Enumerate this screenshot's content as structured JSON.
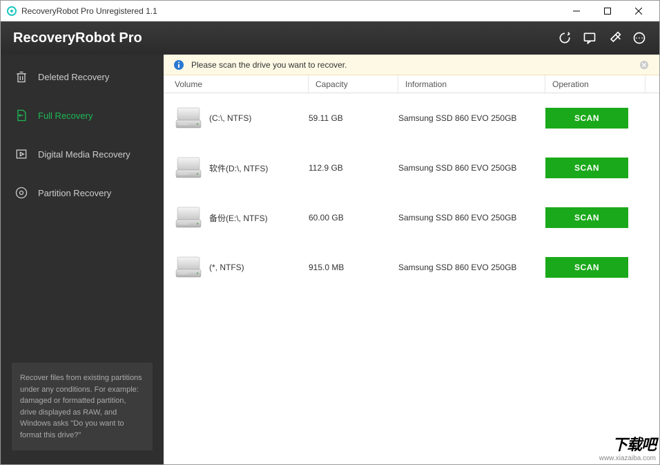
{
  "window": {
    "title": "RecoveryRobot Pro Unregistered 1.1"
  },
  "header": {
    "title": "RecoveryRobot Pro"
  },
  "sidebar": {
    "items": [
      {
        "label": "Deleted Recovery"
      },
      {
        "label": "Full Recovery"
      },
      {
        "label": "Digital Media Recovery"
      },
      {
        "label": "Partition Recovery"
      }
    ],
    "description": "Recover files from existing partitions under any conditions. For example: damaged or formatted partition, drive displayed as RAW, and Windows asks \"Do you want to format this drive?\""
  },
  "notice": {
    "text": "Please scan the drive you want to recover."
  },
  "table": {
    "columns": {
      "volume": "Volume",
      "capacity": "Capacity",
      "information": "Information",
      "operation": "Operation"
    },
    "scan_label": "SCAN",
    "rows": [
      {
        "volume": "(C:\\, NTFS)",
        "capacity": "59.11 GB",
        "info": "Samsung SSD 860 EVO 250GB"
      },
      {
        "volume": "软件(D:\\, NTFS)",
        "capacity": "112.9 GB",
        "info": "Samsung SSD 860 EVO 250GB"
      },
      {
        "volume": "备份(E:\\, NTFS)",
        "capacity": "60.00 GB",
        "info": "Samsung SSD 860 EVO 250GB"
      },
      {
        "volume": "(*, NTFS)",
        "capacity": "915.0 MB",
        "info": "Samsung SSD 860 EVO 250GB"
      }
    ]
  },
  "watermark": {
    "logo": "下载吧",
    "url": "www.xiazaiba.com"
  }
}
